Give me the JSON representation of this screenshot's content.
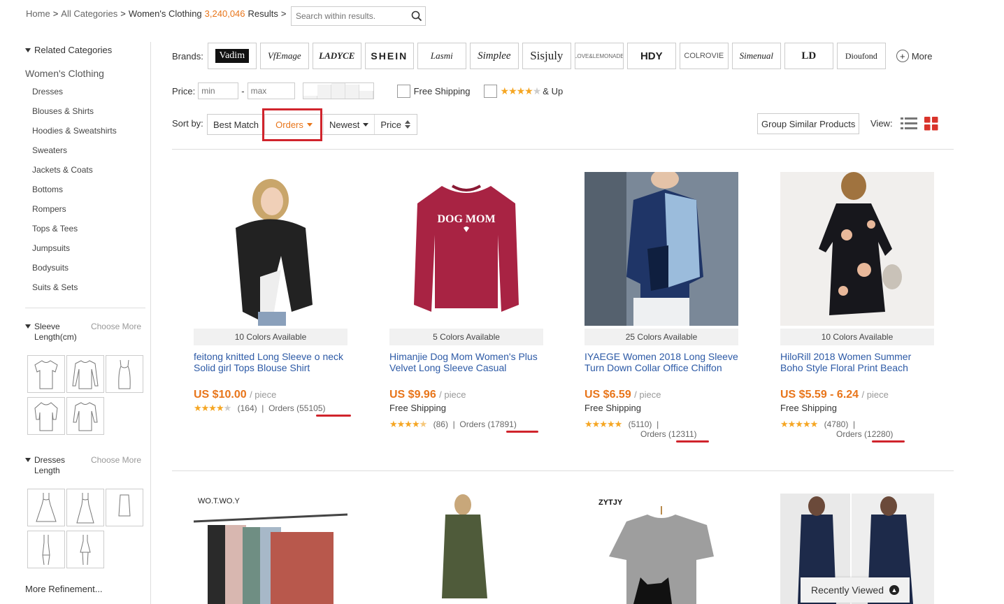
{
  "breadcrumb": {
    "home": "Home",
    "all": "All Categories",
    "current": "Women's Clothing",
    "count": "3,240,046",
    "results": "Results",
    "sep": ">"
  },
  "search": {
    "placeholder": "Search within results."
  },
  "sidebar": {
    "related": "Related Categories",
    "main": "Women's Clothing",
    "subcats": [
      "Dresses",
      "Blouses & Shirts",
      "Hoodies & Sweatshirts",
      "Sweaters",
      "Jackets & Coats",
      "Bottoms",
      "Rompers",
      "Tops & Tees",
      "Jumpsuits",
      "Bodysuits",
      "Suits & Sets"
    ],
    "sleeve": {
      "title": "Sleeve Length(cm)",
      "more": "Choose More"
    },
    "dress": {
      "title": "Dresses Length",
      "more": "Choose More"
    },
    "more_ref": "More Refinement..."
  },
  "filters": {
    "brands_label": "Brands:",
    "brands": [
      "Vadim",
      "VfEmage",
      "LADYCE",
      "SHEIN",
      "Lasmi",
      "Simplee",
      "Sisjuly",
      "LOVE&LEMONADE",
      "HDY",
      "COLROVIE",
      "Simenual",
      "LD",
      "Dioufond"
    ],
    "brands_more": "More",
    "price_label": "Price:",
    "min_placeholder": "min",
    "max_placeholder": "max",
    "free_shipping": "Free Shipping",
    "and_up": "& Up"
  },
  "sort": {
    "label": "Sort by:",
    "best": "Best Match",
    "orders": "Orders",
    "newest": "Newest",
    "price": "Price",
    "group": "Group Similar Products",
    "view": "View:"
  },
  "products": [
    {
      "colors": "10 Colors Available",
      "title": "feitong knitted Long Sleeve o neck Solid girl Tops Blouse Shirt",
      "price": "US $10.00",
      "unit": "/ piece",
      "free": "",
      "reviews": "(164)",
      "orders_label": "Orders",
      "orders": "(55105)"
    },
    {
      "colors": "5 Colors Available",
      "title": "Himanjie Dog Mom Women's Plus Velvet Long Sleeve Casual",
      "price": "US $9.96",
      "unit": "/ piece",
      "free": "Free Shipping",
      "reviews": "(86)",
      "orders_label": "Orders",
      "orders": "(17891)"
    },
    {
      "colors": "25 Colors Available",
      "title": "IYAEGE Women 2018 Long Sleeve Turn Down Collar Office Chiffon",
      "price": "US $6.59",
      "unit": "/ piece",
      "free": "Free Shipping",
      "reviews": "(5110)",
      "orders_label": "Orders",
      "orders": "(12311)"
    },
    {
      "colors": "10 Colors Available",
      "title": "HiloRill 2018 Women Summer Boho Style Floral Print Beach",
      "price": "US $5.59 - 6.24",
      "unit": "/ piece",
      "free": "Free Shipping",
      "reviews": "(4780)",
      "orders_label": "Orders",
      "orders": "(12280)"
    }
  ],
  "row2": {
    "brand1": "WO.T.WO.Y",
    "brand3": "ZYTJY"
  },
  "recently_viewed": "Recently Viewed",
  "colors": {
    "accent": "#e8751a",
    "highlight": "#d0242c",
    "link": "#2d5aa6",
    "star": "#f5a623"
  }
}
